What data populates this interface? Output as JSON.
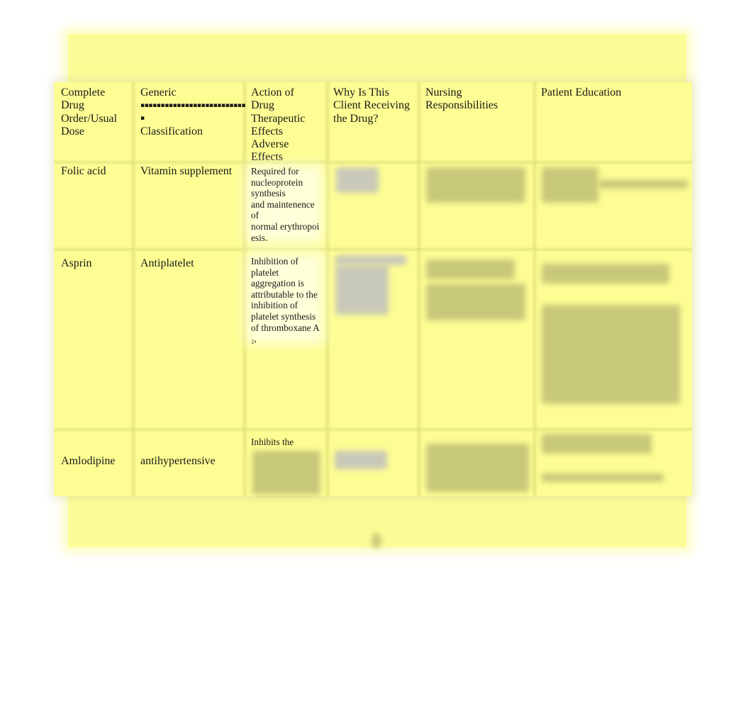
{
  "document": {
    "type": "Drug card table",
    "background_color": "#fcfc96",
    "headers": [
      "Complete\nDrug\nOrder/Usual\nDose",
      "Generic",
      "Classification",
      "Action of\nDrug\nTherapeutic\nEffects\nAdverse\nEffects",
      "Why Is This\nClient Receiving\nthe Drug?",
      "Nursing\nResponsibilities",
      "Patient Education"
    ],
    "generic_separator": "▪▪▪▪▪▪▪▪▪▪▪▪▪▪▪▪▪▪▪▪▪▪▪▪▪▪\n▪",
    "rows": [
      {
        "drug": "Folic acid",
        "classification": "Vitamin supplement",
        "action": "Required for\nnucleoprotein\nsynthesis\nand maintenence\nof\nnormal erythropoi\nesis.",
        "why": "[blurred]",
        "nursing": "[blurred]",
        "education": "[blurred]"
      },
      {
        "drug": "Asprin",
        "classification": "Antiplatelet",
        "action": "Inhibition of\nplatelet\naggregation is\nattributable to the\ninhibition of\nplatelet synthesis\nof thromboxane A\n₂,",
        "why": "[blurred]",
        "nursing": "[blurred]",
        "education": "[blurred]"
      },
      {
        "drug": "Amlodipine",
        "classification": "antihypertensive",
        "action": "Inhibits the",
        "why": "[blurred]",
        "nursing": "[blurred]",
        "education": "[blurred]"
      }
    ],
    "page_number": "[blurred]"
  }
}
